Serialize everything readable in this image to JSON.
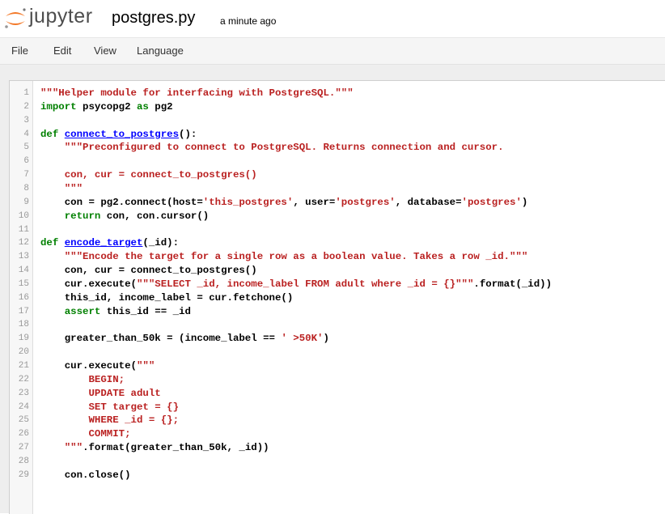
{
  "header": {
    "logo_text": "jupyter",
    "doc_title": "postgres.py",
    "save_status": "a minute ago"
  },
  "menu": [
    "File",
    "Edit",
    "View",
    "Language"
  ],
  "code_lines": [
    [
      [
        "s",
        "\"\"\"Helper module for interfacing with PostgreSQL.\"\"\""
      ]
    ],
    [
      [
        "k",
        "import"
      ],
      [
        "",
        " psycopg2 "
      ],
      [
        "k",
        "as"
      ],
      [
        "",
        " pg2"
      ]
    ],
    [],
    [
      [
        "k",
        "def"
      ],
      [
        "",
        " "
      ],
      [
        "d",
        "connect_to_postgres"
      ],
      [
        "",
        "():"
      ]
    ],
    [
      [
        "",
        "    "
      ],
      [
        "s",
        "\"\"\"Preconfigured to connect to PostgreSQL. Returns connection and cursor."
      ]
    ],
    [],
    [
      [
        "s",
        "    con, cur = connect_to_postgres()"
      ]
    ],
    [
      [
        "s",
        "    \"\"\""
      ]
    ],
    [
      [
        "",
        "    con = pg2.connect(host="
      ],
      [
        "s",
        "'this_postgres'"
      ],
      [
        "",
        ", user="
      ],
      [
        "s",
        "'postgres'"
      ],
      [
        "",
        ", database="
      ],
      [
        "s",
        "'postgres'"
      ],
      [
        "",
        ")"
      ]
    ],
    [
      [
        "",
        "    "
      ],
      [
        "k",
        "return"
      ],
      [
        "",
        " con, con.cursor()"
      ]
    ],
    [],
    [
      [
        "k",
        "def"
      ],
      [
        "",
        " "
      ],
      [
        "d",
        "encode_target"
      ],
      [
        "",
        "(_id):"
      ]
    ],
    [
      [
        "",
        "    "
      ],
      [
        "s",
        "\"\"\"Encode the target for a single row as a boolean value. Takes a row _id.\"\"\""
      ]
    ],
    [
      [
        "",
        "    con, cur = connect_to_postgres()"
      ]
    ],
    [
      [
        "",
        "    cur.execute("
      ],
      [
        "s",
        "\"\"\"SELECT _id, income_label FROM adult where _id = {}\"\"\""
      ],
      [
        "",
        ".format(_id))"
      ]
    ],
    [
      [
        "",
        "    this_id, income_label = cur.fetchone()"
      ]
    ],
    [
      [
        "",
        "    "
      ],
      [
        "k",
        "assert"
      ],
      [
        "",
        " this_id == _id"
      ]
    ],
    [],
    [
      [
        "",
        "    greater_than_50k = (income_label == "
      ],
      [
        "s",
        "' >50K'"
      ],
      [
        "",
        ")"
      ]
    ],
    [],
    [
      [
        "",
        "    cur.execute("
      ],
      [
        "s",
        "\"\"\""
      ]
    ],
    [
      [
        "s",
        "        BEGIN;"
      ]
    ],
    [
      [
        "s",
        "        UPDATE adult"
      ]
    ],
    [
      [
        "s",
        "        SET target = {}"
      ]
    ],
    [
      [
        "s",
        "        WHERE _id = {};"
      ]
    ],
    [
      [
        "s",
        "        COMMIT;"
      ]
    ],
    [
      [
        "s",
        "    \"\"\""
      ],
      [
        "",
        ".format(greater_than_50k, _id))"
      ]
    ],
    [],
    [
      [
        "",
        "    con.close()"
      ]
    ]
  ],
  "colors": {
    "keyword": "#008000",
    "string": "#ba2121",
    "def_name": "#0000ff",
    "logo_orange": "#f37726"
  }
}
